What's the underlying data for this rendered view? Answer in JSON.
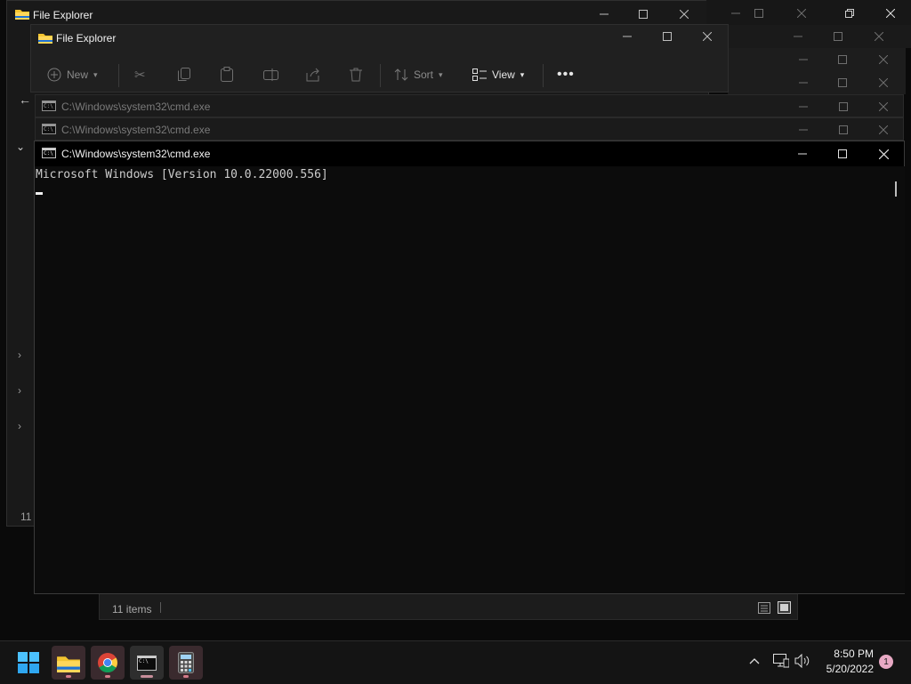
{
  "background_windows": {
    "explorer_back": {
      "title": "File Explorer"
    },
    "explorer_front": {
      "title": "File Explorer",
      "toolbar": {
        "new_label": "New",
        "sort_label": "Sort",
        "view_label": "View"
      },
      "status": {
        "items_count": "11 items",
        "left_partial": "11"
      }
    },
    "cmd_bar_1": {
      "title": "C:\\Windows\\system32\\cmd.exe"
    },
    "cmd_bar_2": {
      "title": "C:\\Windows\\system32\\cmd.exe"
    }
  },
  "cmd": {
    "title": "C:\\Windows\\system32\\cmd.exe",
    "line1": "Microsoft Windows [Version 10.0.22000.556]"
  },
  "taskbar": {
    "clock_time": "8:50 PM",
    "clock_date": "5/20/2022",
    "notification_count": "1"
  },
  "colors": {
    "accent": "#0078d4",
    "folder": "#f4c430",
    "taskbar_indicator": "#d47b8a"
  }
}
